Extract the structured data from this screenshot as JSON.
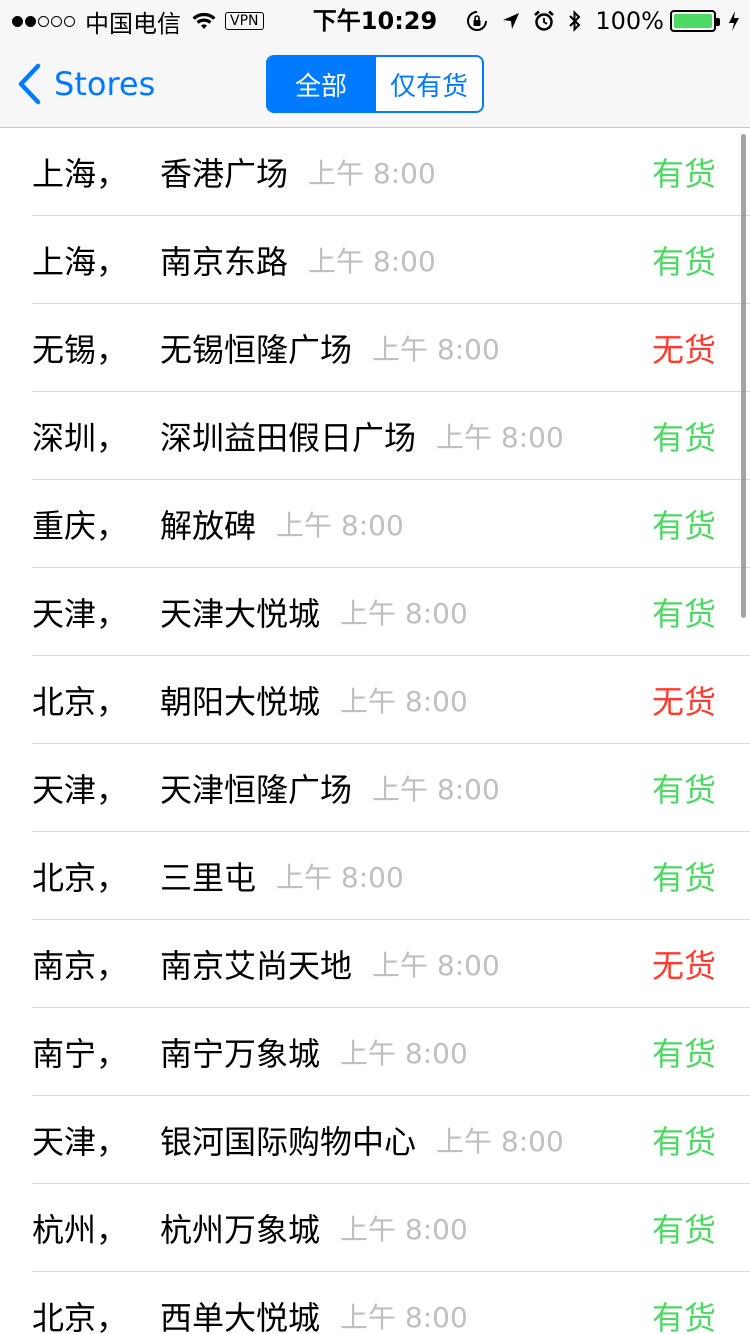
{
  "status_bar": {
    "carrier": "中国电信",
    "vpn": "VPN",
    "time": "下午10:29",
    "battery": "100%"
  },
  "nav": {
    "back_label": "Stores",
    "segments": [
      "全部",
      "仅有货"
    ],
    "active_segment": 0
  },
  "colors": {
    "accent": "#007aff",
    "in_stock": "#4cd964",
    "out_of_stock": "#ff3b30",
    "time_text": "#bfbfbf"
  },
  "stores": [
    {
      "city": "上海，",
      "store": "香港广场",
      "time": "上午 8:00",
      "stock": "有货",
      "in_stock": true
    },
    {
      "city": "上海，",
      "store": "南京东路",
      "time": "上午 8:00",
      "stock": "有货",
      "in_stock": true
    },
    {
      "city": "无锡，",
      "store": "无锡恒隆广场",
      "time": "上午 8:00",
      "stock": "无货",
      "in_stock": false
    },
    {
      "city": "深圳，",
      "store": "深圳益田假日广场",
      "time": "上午 8:00",
      "stock": "有货",
      "in_stock": true
    },
    {
      "city": "重庆，",
      "store": "解放碑",
      "time": "上午 8:00",
      "stock": "有货",
      "in_stock": true
    },
    {
      "city": "天津，",
      "store": "天津大悦城",
      "time": "上午 8:00",
      "stock": "有货",
      "in_stock": true
    },
    {
      "city": "北京，",
      "store": "朝阳大悦城",
      "time": "上午 8:00",
      "stock": "无货",
      "in_stock": false
    },
    {
      "city": "天津，",
      "store": "天津恒隆广场",
      "time": "上午 8:00",
      "stock": "有货",
      "in_stock": true
    },
    {
      "city": "北京，",
      "store": "三里屯",
      "time": "上午 8:00",
      "stock": "有货",
      "in_stock": true
    },
    {
      "city": "南京，",
      "store": "南京艾尚天地",
      "time": "上午 8:00",
      "stock": "无货",
      "in_stock": false
    },
    {
      "city": "南宁，",
      "store": "南宁万象城",
      "time": "上午 8:00",
      "stock": "有货",
      "in_stock": true
    },
    {
      "city": "天津，",
      "store": "银河国际购物中心",
      "time": "上午 8:00",
      "stock": "有货",
      "in_stock": true
    },
    {
      "city": "杭州，",
      "store": "杭州万象城",
      "time": "上午 8:00",
      "stock": "有货",
      "in_stock": true
    },
    {
      "city": "北京，",
      "store": "西单大悦城",
      "time": "上午 8:00",
      "stock": "有货",
      "in_stock": true
    }
  ]
}
